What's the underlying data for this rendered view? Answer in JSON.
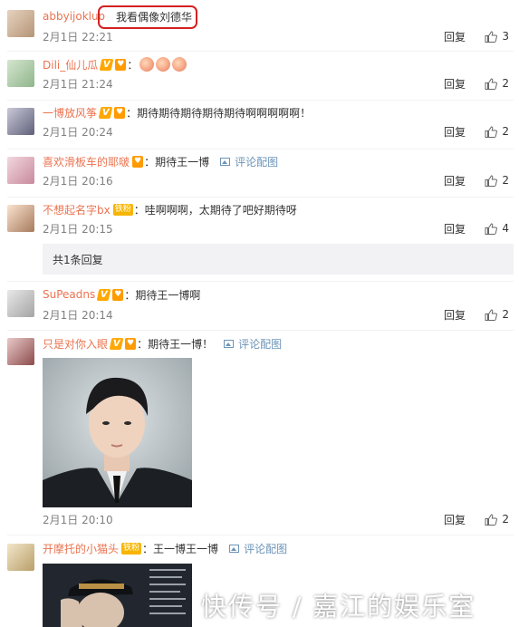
{
  "comments": [
    {
      "user": "abbyijokluo",
      "text": "我看偶像刘德华",
      "time": "2月1日 22:21",
      "reply": "回复",
      "likes": "3"
    },
    {
      "user": "Dili_仙儿瓜",
      "text": "",
      "emoji": [
        "emoji-face",
        "emoji-face",
        "emoji-face"
      ],
      "time": "2月1日 21:24",
      "reply": "回复",
      "likes": "2"
    },
    {
      "user": "一博放风筝",
      "text": "期待期待期待期待期待啊啊啊啊啊！",
      "time": "2月1日 20:24",
      "reply": "回复",
      "likes": "2"
    },
    {
      "user": "喜欢滑板车的耶啵",
      "text": "期待王一博",
      "pic_link": "评论配图",
      "time": "2月1日 20:16",
      "reply": "回复",
      "likes": "2"
    },
    {
      "user": "不想起名字bx",
      "text": "哇啊啊啊，太期待了吧好期待呀",
      "time": "2月1日 20:15",
      "reply": "回复",
      "likes": "4"
    },
    {
      "user": "SuPeadns",
      "text": "期待王一博啊",
      "time": "2月1日 20:14",
      "reply": "回复",
      "likes": "2"
    },
    {
      "user": "只是对你入眼",
      "text": "期待王一博！",
      "pic_link": "评论配图",
      "time": "2月1日 20:10",
      "reply": "回复",
      "likes": "2"
    },
    {
      "user": "开摩托的小猫头",
      "text": "王一博王一博",
      "pic_link": "评论配图"
    }
  ],
  "sub_reply": "共1条回复",
  "badges": {
    "vip": "V",
    "fan": "铁粉"
  },
  "watermark": "快传号 / 嘉江的娱乐室",
  "colors": {
    "username": "#eb7350",
    "link": "#6c94b8",
    "highlight": "#d42121",
    "vip": "#ffa800"
  }
}
